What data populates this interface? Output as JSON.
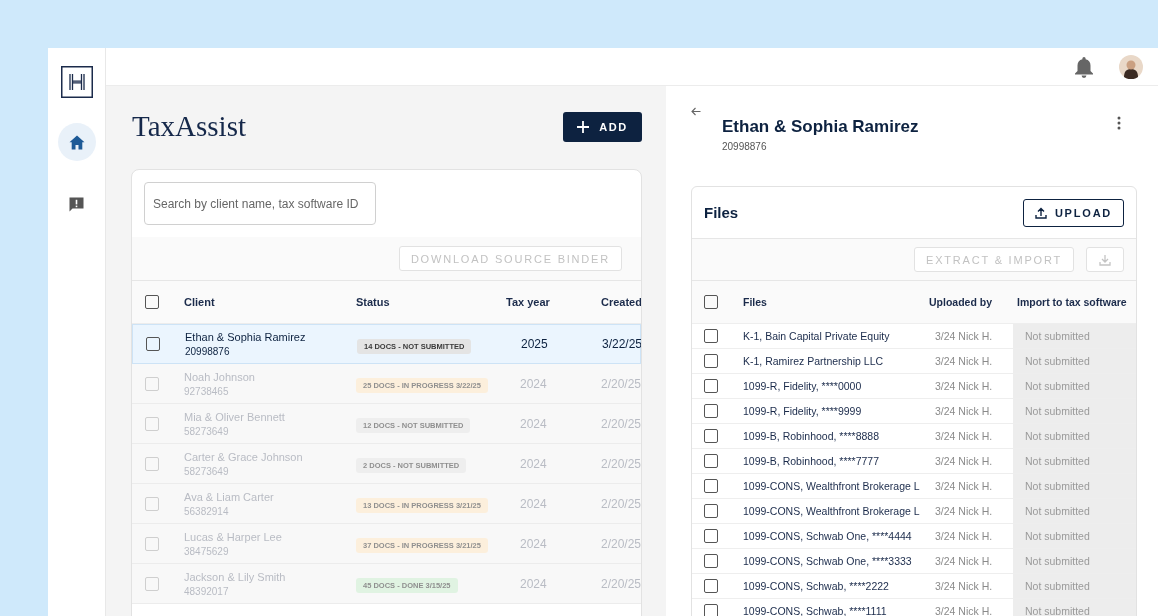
{
  "sidebar": {
    "items": [
      {
        "kind": "home",
        "selected": true
      },
      {
        "kind": "feedback",
        "selected": false
      }
    ]
  },
  "clients": {
    "title": "TaxAssist",
    "add_button": "ADD",
    "search": {
      "placeholder": "Search by client name, tax software ID"
    },
    "download_button": {
      "label": "DOWNLOAD SOURCE BINDER",
      "disabled": true
    },
    "columns": [
      "Client",
      "Status",
      "Tax year",
      "Created"
    ],
    "header_checked": false,
    "rows": [
      {
        "name": "Ethan & Sophia Ramirez",
        "id": "20998876",
        "status": "14 DOCS - NOT SUBMITTED",
        "color": "#e4e4e4",
        "year": "2025",
        "created": "3/22/25",
        "selected": true,
        "checked": false
      },
      {
        "name": "Noah Johnson",
        "id": "92738465",
        "status": "25 DOCS - IN PROGRESS 3/22/25",
        "color": "#fcefdc",
        "year": "2024",
        "created": "2/20/25",
        "selected": false,
        "checked": false
      },
      {
        "name": "Mia & Oliver Bennett",
        "id": "58273649",
        "status": "12 DOCS - NOT SUBMITTED",
        "color": "#eeeeee",
        "year": "2024",
        "created": "2/20/25",
        "selected": false,
        "checked": false
      },
      {
        "name": "Carter & Grace Johnson",
        "id": "58273649",
        "status": "2 DOCS - NOT SUBMITTED",
        "color": "#eeeeee",
        "year": "2024",
        "created": "2/20/25",
        "selected": false,
        "checked": false
      },
      {
        "name": "Ava & Liam Carter",
        "id": "56382914",
        "status": "13 DOCS - IN PROGRESS 3/21/25",
        "color": "#fcefdc",
        "year": "2024",
        "created": "2/20/25",
        "selected": false,
        "checked": false
      },
      {
        "name": "Lucas & Harper Lee",
        "id": "38475629",
        "status": "37 DOCS - IN PROGRESS 3/21/25",
        "color": "#fcefdc",
        "year": "2024",
        "created": "2/20/25",
        "selected": false,
        "checked": false
      },
      {
        "name": "Jackson & Lily Smith",
        "id": "48392017",
        "status": "45 DOCS - DONE 3/15/25",
        "color": "#e0f3e2",
        "year": "2024",
        "created": "2/20/25",
        "selected": false,
        "checked": false
      }
    ]
  },
  "detail": {
    "name": "Ethan & Sophia Ramirez",
    "id": "20998876",
    "files_title": "Files",
    "upload_button": "UPLOAD",
    "extract_button": {
      "label": "EXTRACT & IMPORT",
      "disabled": true
    },
    "download_disabled": true,
    "columns": [
      "Files",
      "Uploaded by",
      "Import to tax software"
    ],
    "header_checked": false,
    "rows": [
      {
        "name": "K-1, Bain Capital Private Equity",
        "uploaded": "3/24 Nick H.",
        "import": "Not submitted",
        "checked": false
      },
      {
        "name": "K-1, Ramirez Partnership LLC",
        "uploaded": "3/24 Nick H.",
        "import": "Not submitted",
        "checked": false
      },
      {
        "name": "1099-R, Fidelity, ****0000",
        "uploaded": "3/24 Nick H.",
        "import": "Not submitted",
        "checked": false
      },
      {
        "name": "1099-R, Fidelity, ****9999",
        "uploaded": "3/24 Nick H.",
        "import": "Not submitted",
        "checked": false
      },
      {
        "name": "1099-B, Robinhood, ****8888",
        "uploaded": "3/24 Nick H.",
        "import": "Not submitted",
        "checked": false
      },
      {
        "name": "1099-B, Robinhood, ****7777",
        "uploaded": "3/24 Nick H.",
        "import": "Not submitted",
        "checked": false
      },
      {
        "name": "1099-CONS, Wealthfront Brokerage L",
        "uploaded": "3/24 Nick H.",
        "import": "Not submitted",
        "checked": false
      },
      {
        "name": "1099-CONS, Wealthfront Brokerage L",
        "uploaded": "3/24 Nick H.",
        "import": "Not submitted",
        "checked": false
      },
      {
        "name": "1099-CONS, Schwab One, ****4444",
        "uploaded": "3/24 Nick H.",
        "import": "Not submitted",
        "checked": false
      },
      {
        "name": "1099-CONS, Schwab One, ****3333",
        "uploaded": "3/24 Nick H.",
        "import": "Not submitted",
        "checked": false
      },
      {
        "name": "1099-CONS, Schwab, ****2222",
        "uploaded": "3/24 Nick H.",
        "import": "Not submitted",
        "checked": false
      },
      {
        "name": "1099-CONS, Schwab, ****1111",
        "uploaded": "3/24 Nick H.",
        "import": "Not submitted",
        "checked": false
      }
    ]
  }
}
